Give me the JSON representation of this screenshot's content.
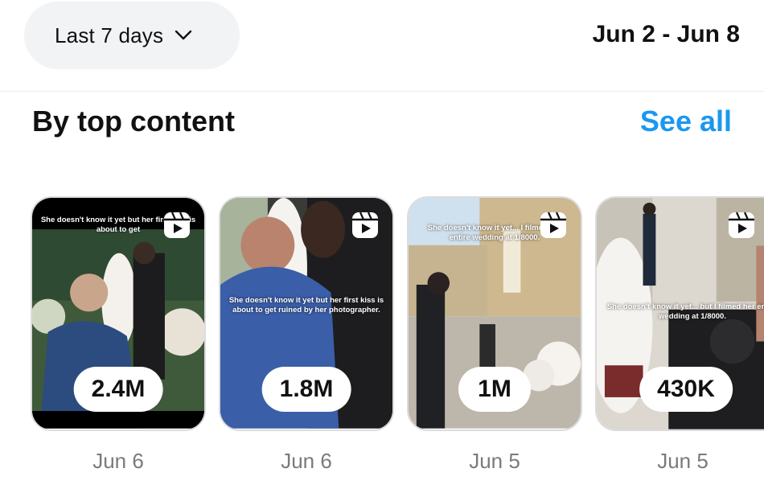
{
  "filter": {
    "label": "Last 7 days",
    "icon": "chevron-down-icon"
  },
  "date_range": "Jun 2 - Jun 8",
  "section": {
    "title": "By top content",
    "see_all": "See all"
  },
  "colors": {
    "accent": "#1a98f0",
    "pill_bg": "#f2f3f5",
    "muted_text": "#7a7a7a"
  },
  "posts": [
    {
      "views": "2.4M",
      "date": "Jun 6",
      "caption": "She doesn't know it yet but her first kiss is about to get"
    },
    {
      "views": "1.8M",
      "date": "Jun 6",
      "caption": "She doesn't know it yet but her first kiss is about to get ruined by her photographer."
    },
    {
      "views": "1M",
      "date": "Jun 5",
      "caption": "She doesn't know it yet... I filmed her entire wedding at 1/8000."
    },
    {
      "views": "430K",
      "date": "Jun 5",
      "caption": "She doesn't know it yet... but I filmed her entire wedding at 1/8000."
    }
  ]
}
